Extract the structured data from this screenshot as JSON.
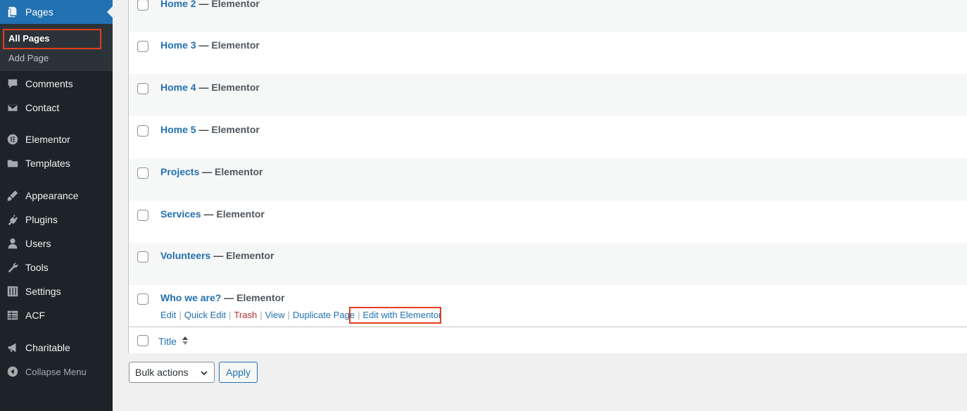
{
  "sidebar": {
    "pages": "Pages",
    "sub_all": "All Pages",
    "sub_add": "Add Page",
    "items": [
      {
        "label": "Comments",
        "icon": "comments-icon"
      },
      {
        "label": "Contact",
        "icon": "mail-icon"
      },
      {
        "label": "Elementor",
        "icon": "elementor-icon"
      },
      {
        "label": "Templates",
        "icon": "folder-icon"
      },
      {
        "label": "Appearance",
        "icon": "paintbrush-icon"
      },
      {
        "label": "Plugins",
        "icon": "plugin-icon"
      },
      {
        "label": "Users",
        "icon": "user-icon"
      },
      {
        "label": "Tools",
        "icon": "wrench-icon"
      },
      {
        "label": "Settings",
        "icon": "sliders-icon"
      },
      {
        "label": "ACF",
        "icon": "table-icon"
      },
      {
        "label": "Charitable",
        "icon": "megaphone-icon"
      }
    ],
    "collapse": "Collapse Menu"
  },
  "rows": [
    {
      "title": "Home 2",
      "state": "Elementor"
    },
    {
      "title": "Home 3",
      "state": "Elementor"
    },
    {
      "title": "Home 4",
      "state": "Elementor"
    },
    {
      "title": "Home 5",
      "state": "Elementor"
    },
    {
      "title": "Projects",
      "state": "Elementor"
    },
    {
      "title": "Services",
      "state": "Elementor"
    },
    {
      "title": "Volunteers",
      "state": "Elementor"
    },
    {
      "title": "Who we are?",
      "state": "Elementor"
    }
  ],
  "dash": "—",
  "row_actions": {
    "edit": "Edit",
    "quick_edit": "Quick Edit",
    "trash": "Trash",
    "view": "View",
    "duplicate": "Duplicate Page",
    "edit_elementor": "Edit with Elementor",
    "separator": "|"
  },
  "footer": {
    "title_column": "Title"
  },
  "bulk_actions": "Bulk actions",
  "apply": "Apply",
  "colors": {
    "accent": "#2271b1",
    "highlight": "#e53e1f",
    "sidebar": "#1d2327",
    "trash": "#b32d2e"
  }
}
